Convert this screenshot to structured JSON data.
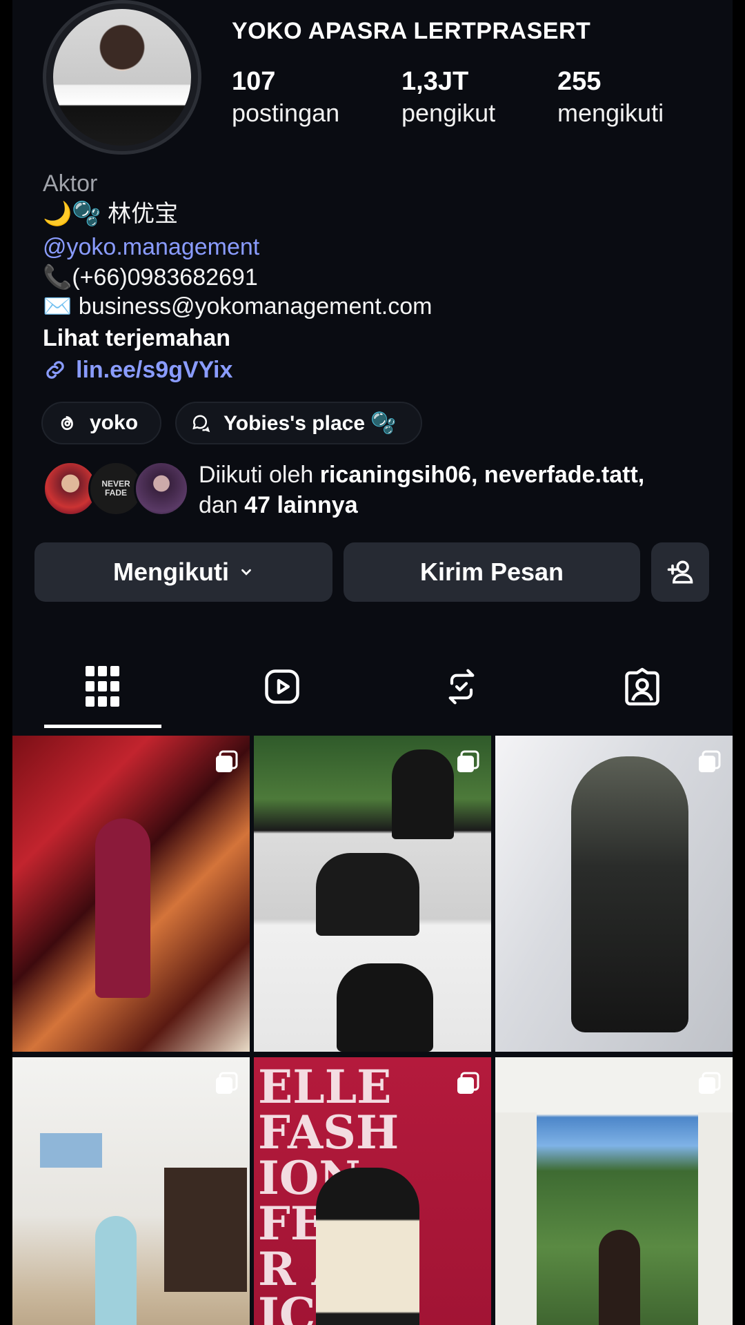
{
  "profile": {
    "username": "YOKO APASRA LERTPRASERT",
    "stats": [
      {
        "value": "107",
        "label": "postingan"
      },
      {
        "value": "1,3JT",
        "label": "pengikut"
      },
      {
        "value": "255",
        "label": "mengikuti"
      }
    ],
    "bio": {
      "category": "Aktor",
      "line1": "🌙🫧 林优宝",
      "threads_handle": "@yoko.management",
      "phone": "📞(+66)0983682691",
      "email": "✉️ business@yokomanagement.com",
      "translate": "Lihat terjemahan",
      "link": "lin.ee/s9gVYix"
    },
    "chips": [
      {
        "icon": "threads-icon",
        "label": "yoko"
      },
      {
        "icon": "broadcast-channel-icon",
        "label": "Yobies's place 🫧"
      }
    ],
    "followed_by": {
      "prefix": "Diikuti oleh ",
      "names": "ricaningsih06, neverfade.tatt,",
      "middle": "dan ",
      "others": "47 lainnya"
    },
    "avatar_badge_text": "NEVER FADE"
  },
  "actions": {
    "follow_label": "Mengikuti",
    "message_label": "Kirim Pesan"
  },
  "tabs": [
    {
      "icon": "grid-icon",
      "active": true
    },
    {
      "icon": "reels-icon",
      "active": false
    },
    {
      "icon": "reposts-icon",
      "active": false
    },
    {
      "icon": "tagged-icon",
      "active": false
    }
  ],
  "posts": [
    {
      "kind": "photo",
      "caption": "",
      "multi": true
    },
    {
      "kind": "photo",
      "caption": "",
      "multi": true
    },
    {
      "kind": "photo",
      "caption": "",
      "multi": true
    },
    {
      "kind": "photo",
      "caption": "",
      "multi": true
    },
    {
      "kind": "photo",
      "caption": "ELLE FASHION FEVER AT ICONSIAM",
      "multi": true
    },
    {
      "kind": "photo",
      "caption": "",
      "multi": true
    }
  ],
  "colors": {
    "background": "#0a0c12",
    "button": "#262a33",
    "link": "#8a9cff"
  }
}
